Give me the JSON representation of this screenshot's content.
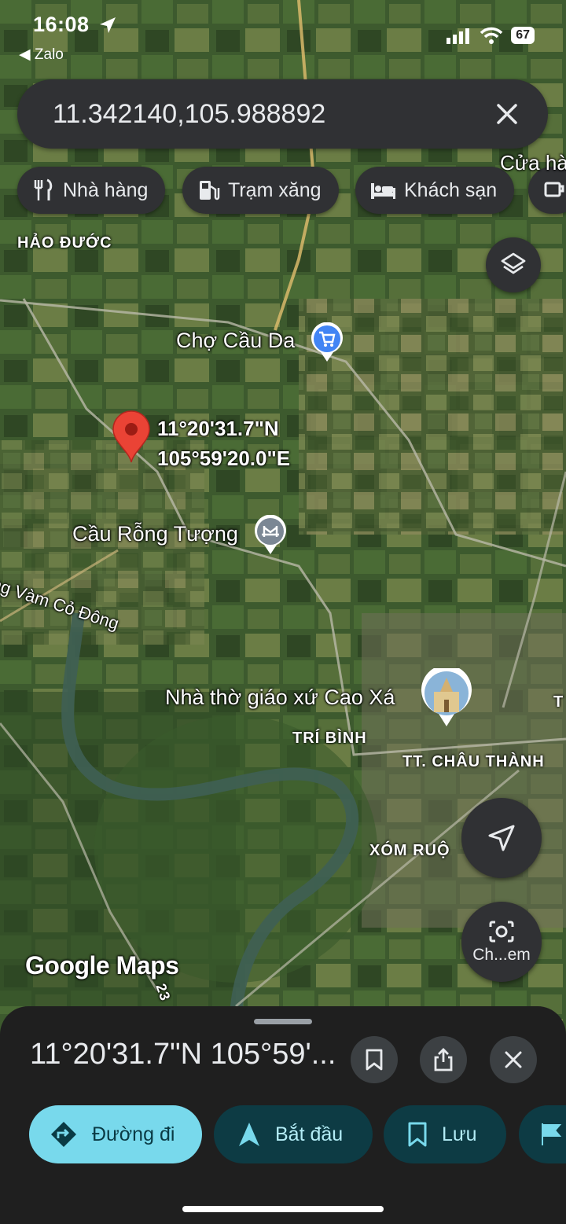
{
  "status_bar": {
    "time": "16:08",
    "back_app": "Zalo",
    "battery": "67"
  },
  "search": {
    "value": "11.342140,105.988892"
  },
  "chips": [
    {
      "label": "Nhà hàng",
      "icon": "fork-knife-icon"
    },
    {
      "label": "Trạm xăng",
      "icon": "gas-station-icon"
    },
    {
      "label": "Khách sạn",
      "icon": "bed-icon"
    }
  ],
  "map_labels": {
    "hao_duoc": "HẢO ĐƯỚC",
    "cua_ha": "Cửa hà",
    "cho_cau_da": "Chợ Cầu Da",
    "pin_lat": "11°20'31.7\"N",
    "pin_lon": "105°59'20.0\"E",
    "cau_rong_tuong": "Cầu Rỗng Tượng",
    "river": "ng Vàm Cỏ Đông",
    "nha_tho": "Nhà thờ giáo xứ Cao Xá",
    "tri_binh": "TRÍ BÌNH",
    "tt_chau_thanh": "TT. CHÂU THÀNH",
    "xom_ruong": "XÓM RUỘ",
    "edge_t": "T",
    "road_23": "23",
    "google_maps_logo": "Google Maps"
  },
  "camera_button": {
    "label": "Ch...em"
  },
  "sheet": {
    "title": "11°20'31.7\"N 105°59'..."
  },
  "actions": [
    {
      "label": "Đường đi"
    },
    {
      "label": "Bắt đầu"
    },
    {
      "label": "Lưu"
    }
  ],
  "colors": {
    "accent_blue": "#4285f4",
    "pin_red": "#ea4335",
    "primary_action": "#78d9ec",
    "secondary_action": "#0d3b44"
  }
}
